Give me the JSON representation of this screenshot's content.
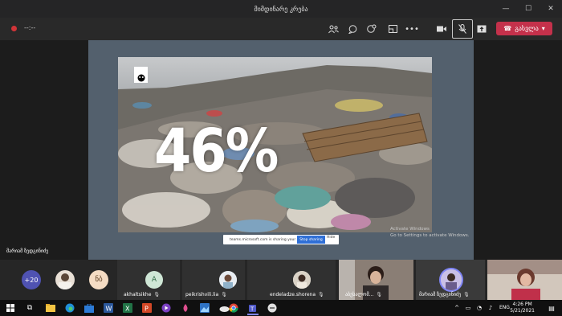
{
  "window": {
    "title": "მიმდინარე კრება"
  },
  "toolbar": {
    "timer": "--:--",
    "leave_label": "გასვლა"
  },
  "slide": {
    "big_number": "46%",
    "logo_text": "WWF"
  },
  "watermark": {
    "line1": "Activate Windows",
    "line2": "Go to Settings to activate Windows."
  },
  "share_bar": {
    "text": "teams.microsoft.com is sharing your screen.",
    "stop_label": "Stop sharing",
    "hide_label": "Hide"
  },
  "presenter_name": "მარიამ ზედგინიძე",
  "participants": {
    "overflow_count": "+20",
    "initials_1": "ნბ",
    "initials_2": "A",
    "names": [
      "akhaltsikhe",
      "peikrishvili.lia",
      "endeladze.shorena",
      "აბესალომ...",
      "მარიამ ზედგინიძე"
    ]
  },
  "taskbar": {
    "lang": "ENG",
    "time": "4:26 PM",
    "date": "5/21/2021"
  },
  "colors": {
    "leave": "#c4314b",
    "record": "#d13438",
    "stop_sharing": "#2f6fd6"
  }
}
